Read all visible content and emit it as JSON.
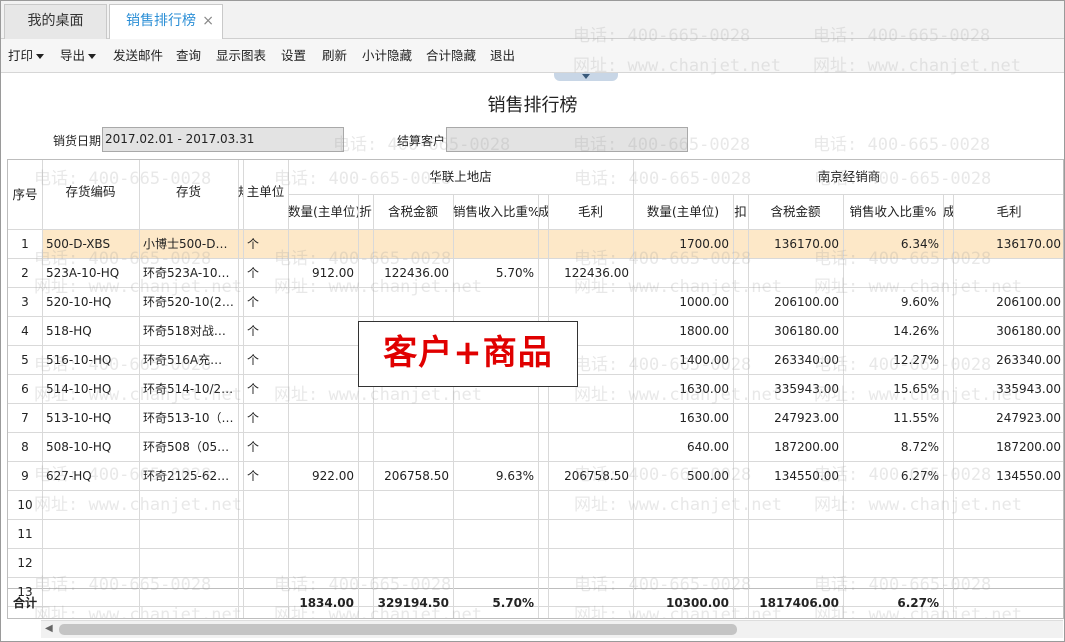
{
  "tabs": {
    "home": "我的桌面",
    "active": "销售排行榜",
    "close": "×"
  },
  "toolbar": {
    "print": "打印",
    "export": "导出",
    "send_mail": "发送邮件",
    "query": "查询",
    "show_chart": "显示图表",
    "settings": "设置",
    "refresh": "刷新",
    "hide_subtotal": "小计隐藏",
    "hide_total": "合计隐藏",
    "exit": "退出"
  },
  "report": {
    "title": "销售排行榜",
    "date_label": "销货日期",
    "date_value": "2017.02.01 - 2017.03.31",
    "customer_label": "结算客户",
    "customer_value": ""
  },
  "table": {
    "h_seq": "序号",
    "h_code": "存货编码",
    "h_item": "存货",
    "h_spec": "规",
    "h_unit": "主单位",
    "store1": "华联上地店",
    "store2": "南京经销商",
    "h_qty": "数量(主单位)",
    "h_disc": "折",
    "h_tax": "含税金额",
    "h_ratio": "销售收入比重%",
    "h_cost": "成",
    "h_profit": "毛利",
    "h_disc2": "扣",
    "h_ratio2": "销售收入比重%",
    "h_cost2": "成",
    "rows": [
      {
        "seq": "1",
        "code": "500-D-XBS",
        "item": "小博士500-D…",
        "unit": "个",
        "q1": "",
        "t1": "",
        "p1": "",
        "g1": "",
        "q2": "1700.00",
        "t2": "136170.00",
        "p2": "6.34%",
        "g2": "136170.00"
      },
      {
        "seq": "2",
        "code": "523A-10-HQ",
        "item": "环奇523A-10…",
        "unit": "个",
        "q1": "912.00",
        "t1": "122436.00",
        "p1": "5.70%",
        "g1": "122436.00",
        "q2": "",
        "t2": "",
        "p2": "",
        "g2": ""
      },
      {
        "seq": "3",
        "code": "520-10-HQ",
        "item": "环奇520-10(2…",
        "unit": "个",
        "q1": "",
        "t1": "",
        "p1": "",
        "g1": "",
        "q2": "1000.00",
        "t2": "206100.00",
        "p2": "9.60%",
        "g2": "206100.00"
      },
      {
        "seq": "4",
        "code": "518-HQ",
        "item": "环奇518对战…",
        "unit": "个",
        "q1": "",
        "t1": "",
        "p1": "",
        "g1": "",
        "q2": "1800.00",
        "t2": "306180.00",
        "p2": "14.26%",
        "g2": "306180.00"
      },
      {
        "seq": "5",
        "code": "516-10-HQ",
        "item": "环奇516A充…",
        "unit": "个",
        "q1": "",
        "t1": "",
        "p1": "",
        "g1": "",
        "q2": "1400.00",
        "t2": "263340.00",
        "p2": "12.27%",
        "g2": "263340.00"
      },
      {
        "seq": "6",
        "code": "514-10-HQ",
        "item": "环奇514-10/2…",
        "unit": "个",
        "q1": "",
        "t1": "",
        "p1": "",
        "g1": "",
        "q2": "1630.00",
        "t2": "335943.00",
        "p2": "15.65%",
        "g2": "335943.00"
      },
      {
        "seq": "7",
        "code": "513-10-HQ",
        "item": "环奇513-10（…",
        "unit": "个",
        "q1": "",
        "t1": "",
        "p1": "",
        "g1": "",
        "q2": "1630.00",
        "t2": "247923.00",
        "p2": "11.55%",
        "g2": "247923.00"
      },
      {
        "seq": "8",
        "code": "508-10-HQ",
        "item": "环奇508（05…",
        "unit": "个",
        "q1": "",
        "t1": "",
        "p1": "",
        "g1": "",
        "q2": "640.00",
        "t2": "187200.00",
        "p2": "8.72%",
        "g2": "187200.00"
      },
      {
        "seq": "9",
        "code": "627-HQ",
        "item": "环奇2125-62…",
        "unit": "个",
        "q1": "922.00",
        "t1": "206758.50",
        "p1": "9.63%",
        "g1": "206758.50",
        "q2": "500.00",
        "t2": "134550.00",
        "p2": "6.27%",
        "g2": "134550.00"
      },
      {
        "seq": "10",
        "code": "",
        "item": "",
        "unit": "",
        "q1": "",
        "t1": "",
        "p1": "",
        "g1": "",
        "q2": "",
        "t2": "",
        "p2": "",
        "g2": ""
      },
      {
        "seq": "11",
        "code": "",
        "item": "",
        "unit": "",
        "q1": "",
        "t1": "",
        "p1": "",
        "g1": "",
        "q2": "",
        "t2": "",
        "p2": "",
        "g2": ""
      },
      {
        "seq": "12",
        "code": "",
        "item": "",
        "unit": "",
        "q1": "",
        "t1": "",
        "p1": "",
        "g1": "",
        "q2": "",
        "t2": "",
        "p2": "",
        "g2": ""
      },
      {
        "seq": "13",
        "code": "",
        "item": "",
        "unit": "",
        "q1": "",
        "t1": "",
        "p1": "",
        "g1": "",
        "q2": "",
        "t2": "",
        "p2": "",
        "g2": ""
      }
    ],
    "total": {
      "label": "合计",
      "q1": "1834.00",
      "t1": "329194.50",
      "p1": "5.70%",
      "q2": "10300.00",
      "t2": "1817406.00",
      "p2": "6.27%"
    }
  },
  "overlay_text": "客户+商品",
  "watermark": {
    "phone": "电话: 400-665-0028",
    "site": "网址: www.chanjet.net"
  },
  "colors": {
    "highlight_row": "#fde8c8",
    "overlay_text": "#e00000",
    "active_tab": "#2c8fd6"
  }
}
